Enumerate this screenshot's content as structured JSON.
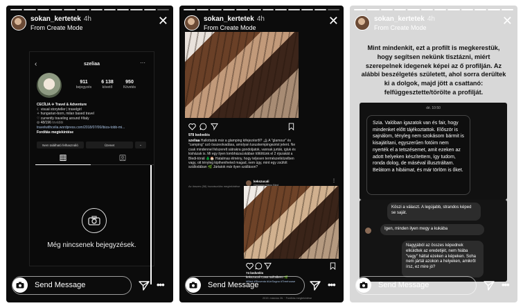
{
  "story": {
    "username": "sokan_kertetek",
    "age": "4h",
    "subtitle": "From Create Mode",
    "close_glyph": "✕",
    "send_message": "Send Message",
    "more_glyph": "•••"
  },
  "profile": {
    "back_glyph": "‹",
    "username": "szeliaa",
    "more_glyph": "···",
    "stats": [
      {
        "num": "911",
        "label": "bejegyzés"
      },
      {
        "num": "6 138",
        "label": "követő"
      },
      {
        "num": "950",
        "label": "Követés"
      }
    ],
    "bio": {
      "name": "CECÍLIA ✈ Travel & Adventure",
      "line1": "☾ visual storyteller | travelgirl",
      "line2": "✧ hungarian-born, milan based travel",
      "line3": "♡ currently traveling around #Italy",
      "line4": "⊙ 48/196",
      "line4_more": "további",
      "link": "travelwithcelia.wordpress.com/2018/07/06/ibiza-tobb-mi...",
      "translate": "Fordítás megtekintése"
    },
    "btn_notfound": "Nem található felhasználó",
    "btn_message": "Üzenet",
    "btn_arrow": "⌄",
    "empty_text": "Még nincsenek bejegyzések."
  },
  "post": {
    "likes1": "978 kedvelés",
    "caption_user": "szeliaa",
    "caption": "Hallottatok már a glamping kifejezésről? 🏕 A \"glamour\" és \"camping\" szó összeolvadása, amolyan luxuskempingezést jelent. Ne csak mindennel felszerelt sátrakra gondoljatok, vannak jurták, igluk és kisházak is. Mi egy ilyen lombházacskában töltöttünk el 2 éjszakát a Bledi-tónál 🌲🏠 Hatalmas élmény, hogy teljesen természetközelben vagy, ott tényleg kipiheniheted magad, nem úgy, mint egy zsúfolt szállodában 🌿 Jártatok már ilyen szálláson?",
    "translate_small": "Az összes (58) hozzászólás megtekintése",
    "overlay_user": "kekszucali",
    "overlay_sub": "Glamping Ribno Bled",
    "likes2": "74 kedvelés",
    "caption2": "kekszucali Casa sull'albero 🌿",
    "hashtags": "#Bled #Slovenia #UnSogno #Treehouse",
    "small_meta": "4 hozzászólás megtekintése",
    "date": "2019. március 26.",
    "translate2": "Fordítás megtekintése"
  },
  "chat": {
    "intro": "Mint mindenkit, ezt a profilt is megkerestük, hogy segítsen nekünk tisztázni, miért szerepelnek idegenek képei az ő profilján. Az alábbi beszélgetés született, ahol sorra derültek ki a dolgok, majd jött a csattanó: felfüggesztette/törölte a profilját.",
    "time": "dé. 10:50",
    "msg1": "Szia. Valóban igazatok van és fair, hogy mindenket előtt tájékoztattok. Először is sajnálom, tényleg nem szokásom bármit is kisajátítani, egyszerűen fotóim nem nyerték el a tetszésemet, amit ezeken az adott helyeken készítettem, így tudom, ronda dolog, de máséval illusztráltam. Belátom a hibáimat, és már törlöm is őket.",
    "msg2": "Köszi a választ. A legújabb, strandos képed se saját.",
    "msg3": "Igen, minden ilyen megy a kukába",
    "msg4": "Nagyjából az összes képednek elküldtek az eredetijét, nem hiába \"vagy\" háttal ezeken a képeken. Soha nem jártál azokon a helyeken, amikről írsz, ez mire jó?"
  },
  "colors": {
    "story_dark": "#0c0c0c",
    "story_light": "#d8d8d8",
    "bubble": "#2c2c2c",
    "link": "#a9c3e5"
  },
  "icons": [
    "camera-icon",
    "send-icon",
    "close-icon",
    "heart-icon",
    "comment-icon",
    "share-icon",
    "bookmark-icon",
    "grid-icon",
    "tag-icon"
  ]
}
